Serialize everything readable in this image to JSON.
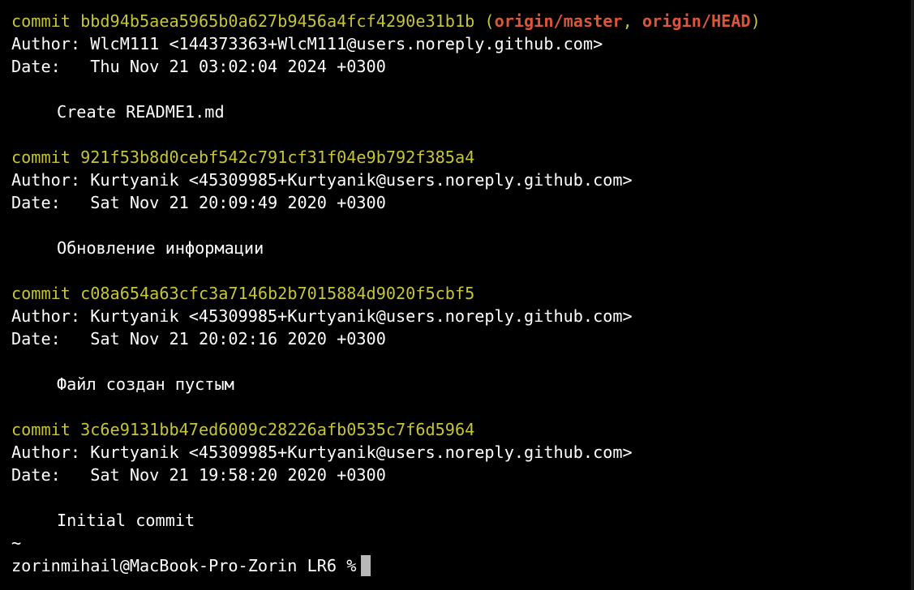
{
  "terminal": {
    "commits": [
      {
        "keyword": "commit",
        "hash": "bbd94b5aea5965b0a627b9456a4fcf4290e31b1b",
        "refs_open": "(",
        "ref1": "origin/master",
        "ref_sep": ", ",
        "ref2": "origin/HEAD",
        "refs_close": ")",
        "author_label": "Author:",
        "author": "WlcM111 <144373363+WlcM111@users.noreply.github.com>",
        "date_label": "Date:",
        "date": "Thu Nov 21 03:02:04 2024 +0300",
        "message": "Create README1.md"
      },
      {
        "keyword": "commit",
        "hash": "921f53b8d0cebf542c791cf31f04e9b792f385a4",
        "author_label": "Author:",
        "author": "Kurtyanik <45309985+Kurtyanik@users.noreply.github.com>",
        "date_label": "Date:",
        "date": "Sat Nov 21 20:09:49 2020 +0300",
        "message": "Обновление информации"
      },
      {
        "keyword": "commit",
        "hash": "c08a654a63cfc3a7146b2b7015884d9020f5cbf5",
        "author_label": "Author:",
        "author": "Kurtyanik <45309985+Kurtyanik@users.noreply.github.com>",
        "date_label": "Date:",
        "date": "Sat Nov 21 20:02:16 2020 +0300",
        "message": "Файл создан пустым"
      },
      {
        "keyword": "commit",
        "hash": "3c6e9131bb47ed6009c28226afb0535c7f6d5964",
        "author_label": "Author:",
        "author": "Kurtyanik <45309985+Kurtyanik@users.noreply.github.com>",
        "date_label": "Date:",
        "date": "Sat Nov 21 19:58:20 2020 +0300",
        "message": "Initial commit"
      }
    ],
    "pager_end": "~",
    "prompt": "zorinmihail@MacBook-Pro-Zorin LR6 %"
  },
  "colors": {
    "background": "#000000",
    "text": "#ffffff",
    "hash": "#c6c43a",
    "ref": "#d9573a",
    "cursor": "#b8b8b8"
  }
}
